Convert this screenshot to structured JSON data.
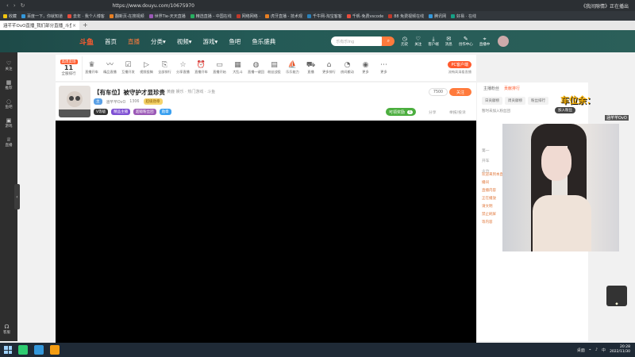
{
  "browser": {
    "active_tab_label": "涵芊芊OvO直播_我们部分直播_斗鱼",
    "url": "https://www.douyu.com/10675970",
    "right_text": "《我间隙情》正在播出",
    "bookmarks": [
      "收藏",
      "百度一下，你就知道",
      "去年 · 我个人博客",
      "翻新页-在搜视频",
      "世界Tie-天天直播",
      "精选直播 - 中国在线",
      "",
      "网络网络 ·",
      "网易 ·",
      "虎牙直播 - 技术观",
      "千牛网-淘宝客客",
      "千帆-免费vscode",
      "88 免费视频在线",
      "腾讯网",
      "腾讯网",
      "好易 · 在线",
      "技术工作"
    ]
  },
  "header": {
    "logo": "斗鱼",
    "nav": [
      "首页",
      "直播",
      "分类▾",
      "视频▾",
      "游戏▾",
      "鱼吧",
      "鱼乐盛典"
    ],
    "active_nav": "直播",
    "search_placeholder": "乐有乐Ing",
    "search_icon": "search-icon",
    "icons": [
      {
        "label": "历史",
        "icon": "clock-icon"
      },
      {
        "label": "关注",
        "icon": "heart-icon"
      },
      {
        "label": "客户端",
        "icon": "download-icon"
      },
      {
        "label": "消息",
        "icon": "bell-icon"
      },
      {
        "label": "创作中心",
        "icon": "pen-icon"
      },
      {
        "label": "直播中",
        "icon": "camera-icon"
      }
    ]
  },
  "leftbar": {
    "items": [
      "关注",
      "推荐",
      "鱼吧",
      "游戏",
      "直播"
    ],
    "bottom": "客服"
  },
  "tools": {
    "rank_badge": "高周卖场",
    "rank_number": "11",
    "rank_label": "全服排行",
    "items": [
      "直播开车",
      "精品直播",
      "互播开发",
      "视频投稿",
      "全部排行",
      "分享直播",
      "直播开车",
      "直播开始",
      "大乱斗",
      "直播一键回",
      "粉丝战役",
      "乐乐能力",
      "直播",
      "更多排行",
      "房间搬动",
      "更多"
    ],
    "pc_button": "PC客户端",
    "pc_sub": "流畅高清看直播"
  },
  "room": {
    "title": "【有车位】被守护才显珍贵",
    "tag": "黄鹿  娱乐 · 热门游戏 · 斗鱼",
    "anchor": "涵芊芊OvO",
    "hot": "1306",
    "honor": "超级勋章",
    "follow_count": "7500",
    "follow_label": "关注",
    "badges": [
      "V等级",
      "精品主播",
      "超级粉丝团",
      "勋章"
    ],
    "chuiniu_label": "可领奖励",
    "chuiniu_num": "1",
    "share": "分享",
    "report": "举报/投诉"
  },
  "rightpanel": {
    "tabs": [
      "主播粉丝",
      "贡献排行"
    ],
    "active_tab": "贡献排行",
    "subtabs": [
      "日贡献榜",
      "周贡献榜",
      "粉丝排行"
    ],
    "hint": "暂时未加入粉丝团",
    "join_button": "加入粉丝",
    "chat_lines": [
      "第一",
      "开车",
      "火力"
    ],
    "chat_orange": [
      "欢迎来到本直播间",
      "直播内容",
      "正在播放",
      "请文明",
      "禁止刷屏",
      "等内容"
    ]
  },
  "overlay": {
    "text": "车位余：",
    "nickname": "涵芊芊OvO"
  },
  "taskbar": {
    "tray_text": "桌面",
    "time": "20:28",
    "date": "2022/11/30"
  }
}
